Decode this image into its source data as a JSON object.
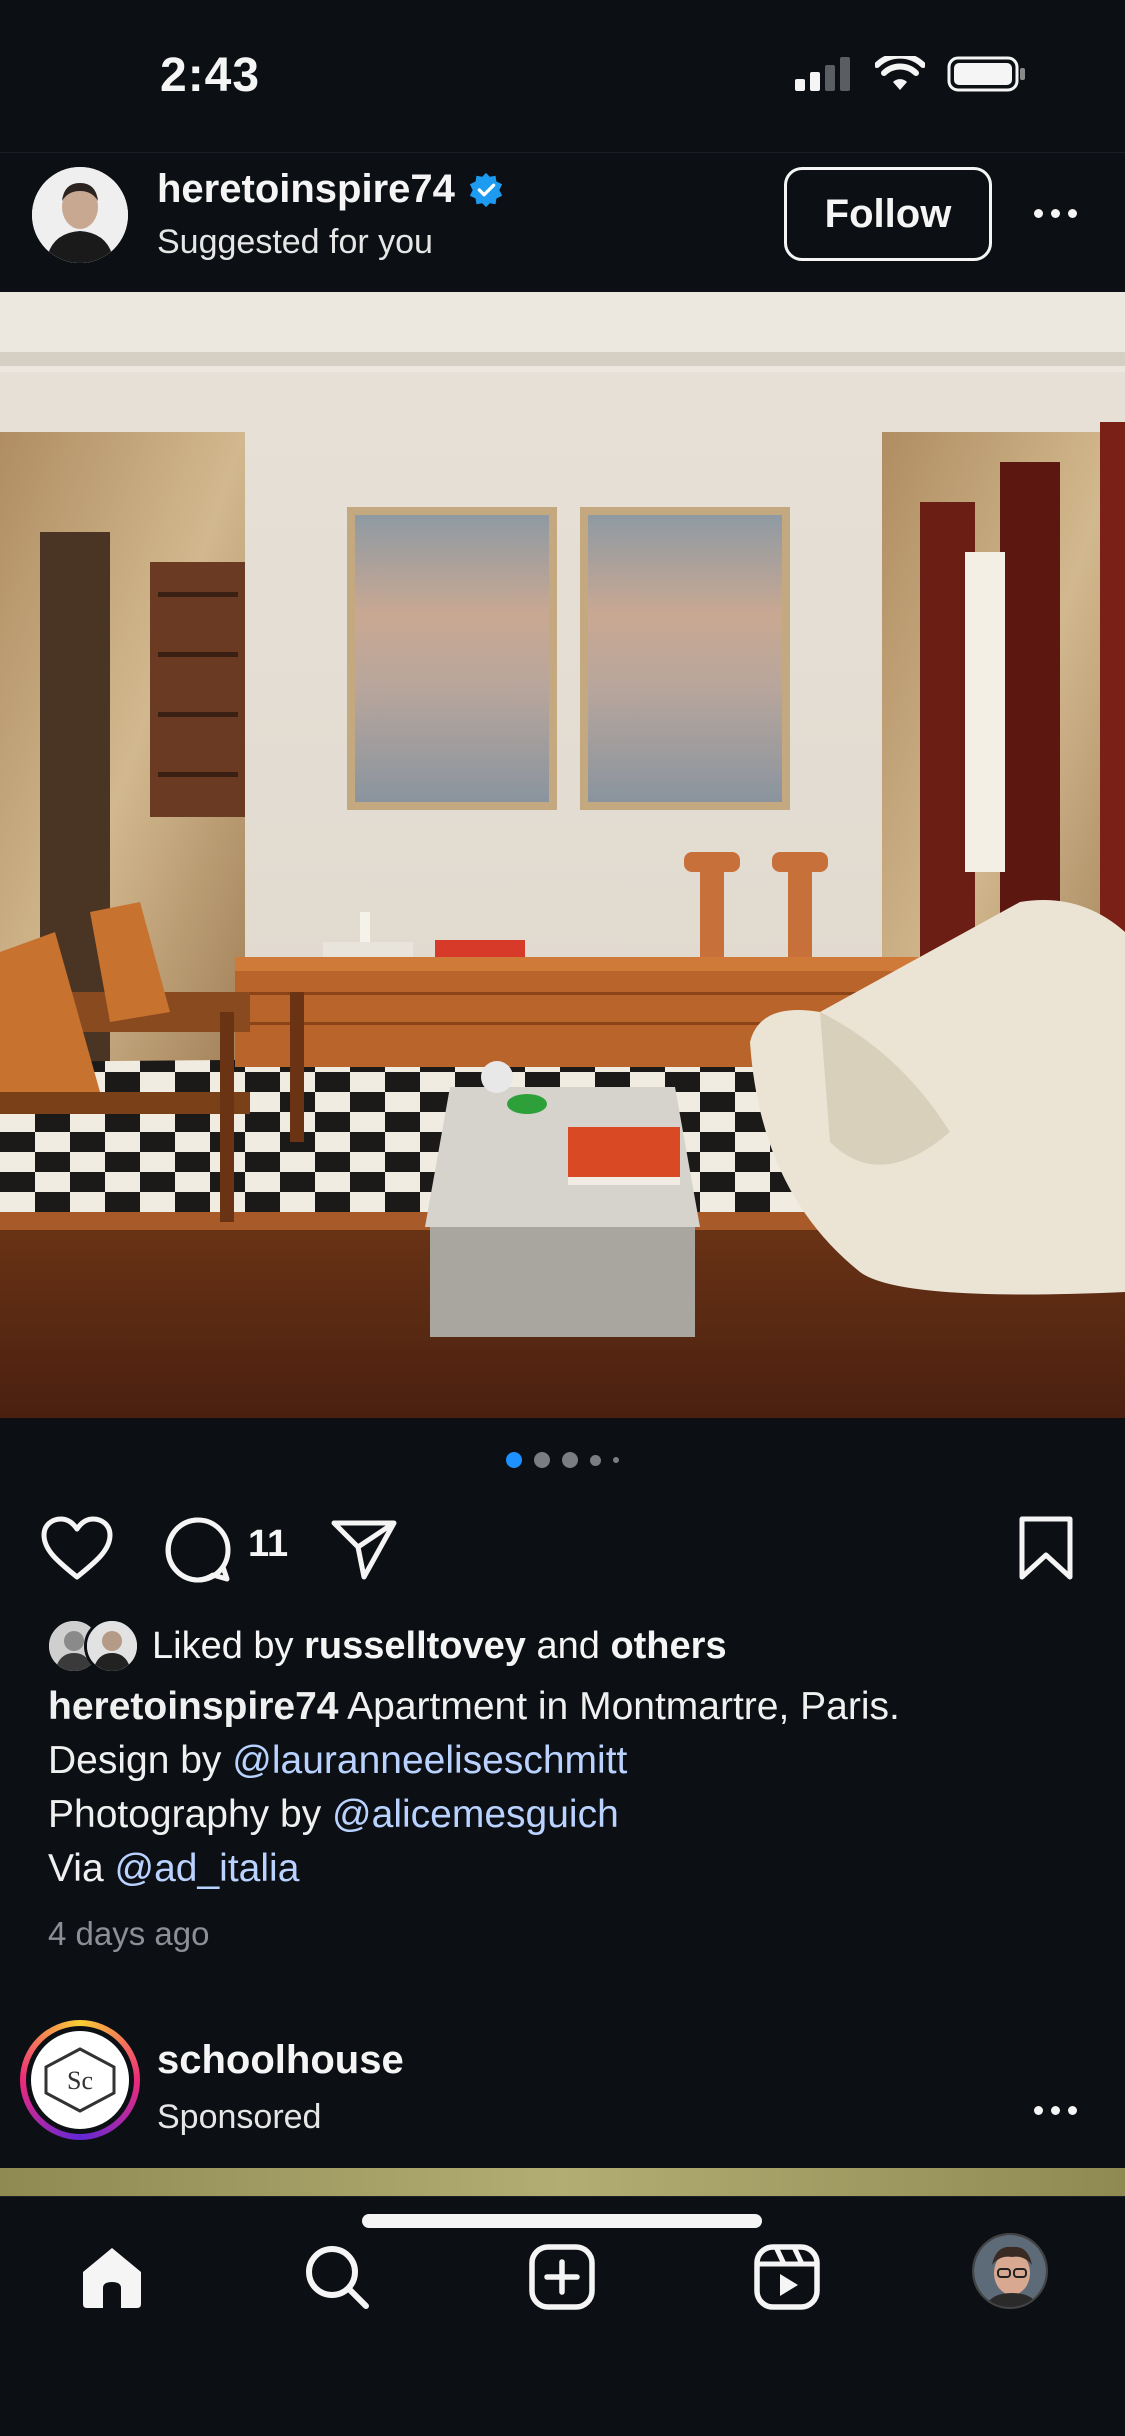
{
  "status_bar": {
    "time": "2:43",
    "icons": [
      "signal-icon",
      "wifi-icon",
      "battery-icon"
    ]
  },
  "post": {
    "username": "heretoinspire74",
    "verified": true,
    "subline": "Suggested for you",
    "follow_label": "Follow",
    "carousel": {
      "total": 5,
      "active_index": 0
    },
    "comment_count": "11",
    "liked_by": {
      "prefix": "Liked by",
      "user": "russelltovey",
      "joiner": "and",
      "others": "others"
    },
    "caption": {
      "username": "heretoinspire74",
      "line1": "Apartment in Montmartre, Paris.",
      "line2_prefix": "Design by",
      "line2_mention": "@lauranneeliseschmitt",
      "line3_prefix": "Photography by",
      "line3_mention": "@alicemesguich",
      "line4_prefix": "Via",
      "line4_mention": "@ad_italia"
    },
    "time_ago": "4 days ago"
  },
  "sponsored_post": {
    "username": "schoolhouse",
    "subline": "Sponsored",
    "logo_text": "Sc"
  },
  "tabbar": {
    "items": [
      "home-icon",
      "search-icon",
      "create-icon",
      "reels-icon",
      "profile-avatar"
    ]
  },
  "colors": {
    "background": "#0c1014",
    "verified": "#1d9bf0",
    "mention": "#b9d2ff",
    "active_dot": "#1e90ff"
  }
}
